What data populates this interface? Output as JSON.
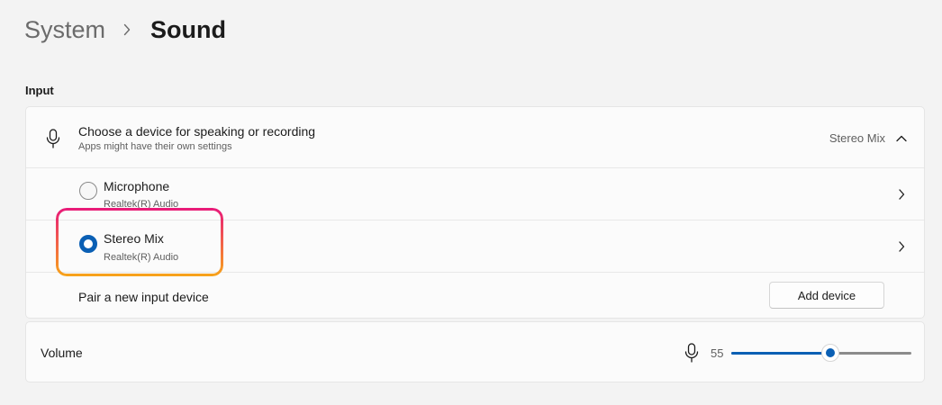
{
  "breadcrumb": {
    "parent": "System",
    "current": "Sound"
  },
  "input_section": {
    "label": "Input",
    "header": {
      "title": "Choose a device for speaking or recording",
      "subtitle": "Apps might have their own settings",
      "selected_value": "Stereo Mix",
      "icon": "microphone-icon",
      "expanded": true
    },
    "devices": [
      {
        "name": "Microphone",
        "driver": "Realtek(R) Audio",
        "selected": false
      },
      {
        "name": "Stereo Mix",
        "driver": "Realtek(R) Audio",
        "selected": true
      }
    ],
    "pair": {
      "label": "Pair a new input device",
      "button_label": "Add device"
    }
  },
  "volume": {
    "label": "Volume",
    "value": "55",
    "level": 0.55,
    "icon": "microphone-icon"
  },
  "colors": {
    "accent": "#0a5fb4",
    "background": "#f3f3f3",
    "card": "#fbfbfb",
    "highlight_top": "#e8197a",
    "highlight_bottom": "#f7a41a"
  }
}
